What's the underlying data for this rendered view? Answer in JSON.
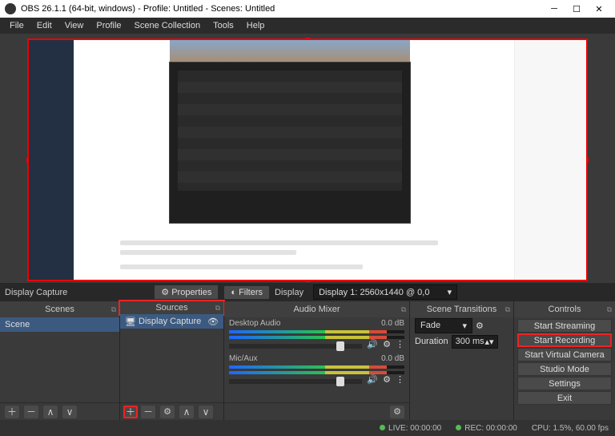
{
  "titlebar": {
    "title": "OBS 26.1.1 (64-bit, windows) - Profile: Untitled - Scenes: Untitled"
  },
  "menu": {
    "items": [
      "File",
      "Edit",
      "View",
      "Profile",
      "Scene Collection",
      "Tools",
      "Help"
    ]
  },
  "sourceInfo": {
    "name": "Display Capture",
    "propertiesLabel": "Properties",
    "filtersLabel": "Filters",
    "displayLabel": "Display",
    "displayValue": "Display 1: 2560x1440 @ 0,0"
  },
  "panels": {
    "scenes": {
      "title": "Scenes",
      "items": [
        "Scene"
      ]
    },
    "sources": {
      "title": "Sources",
      "items": [
        "Display Capture"
      ]
    },
    "mixer": {
      "title": "Audio Mixer",
      "channels": [
        {
          "name": "Desktop Audio",
          "db": "0.0 dB"
        },
        {
          "name": "Mic/Aux",
          "db": "0.0 dB"
        }
      ]
    },
    "transitions": {
      "title": "Scene Transitions",
      "mode": "Fade",
      "durLabel": "Duration",
      "durValue": "300 ms"
    },
    "controls": {
      "title": "Controls",
      "buttons": [
        "Start Streaming",
        "Start Recording",
        "Start Virtual Camera",
        "Studio Mode",
        "Settings",
        "Exit"
      ]
    }
  },
  "status": {
    "live": "LIVE: 00:00:00",
    "rec": "REC: 00:00:00",
    "cpu": "CPU: 1.5%, 60.00 fps"
  },
  "icons": {
    "plus": "＋",
    "minus": "－",
    "up": "∧",
    "down": "∨",
    "gear": "⚙",
    "eye": "👁",
    "speaker": "🔊",
    "dots": "⋮",
    "props": "⚙",
    "filter": "◐",
    "chev": "▾",
    "popout": "⧉"
  }
}
